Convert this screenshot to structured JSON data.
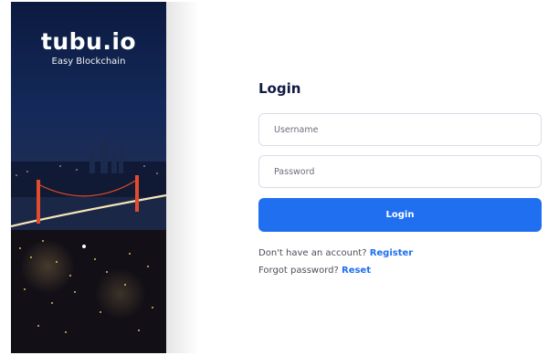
{
  "brand": {
    "logo": "tubu.io",
    "tagline": "Easy Blockchain"
  },
  "login": {
    "title": "Login",
    "username_placeholder": "Username",
    "password_placeholder": "Password",
    "button_label": "Login",
    "register_prompt": "Don't have an account?",
    "register_link": "Register",
    "forgot_prompt": "Forgot password?",
    "reset_link": "Reset"
  },
  "colors": {
    "accent": "#1f6ff0",
    "title": "#0f1b44"
  }
}
